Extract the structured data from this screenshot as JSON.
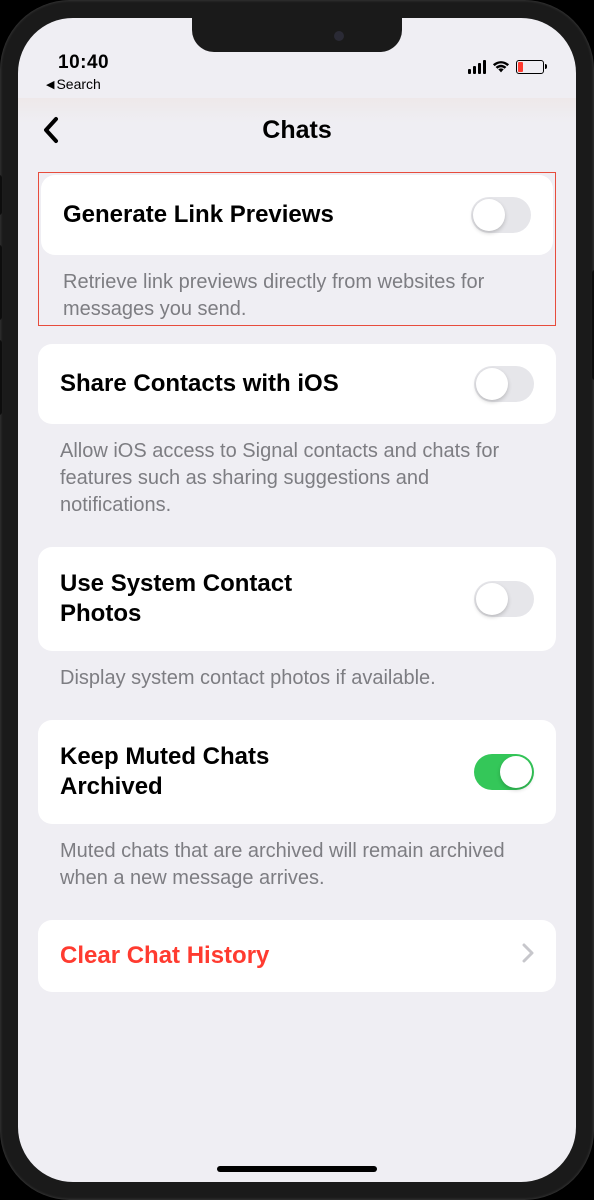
{
  "status": {
    "time": "10:40",
    "breadcrumb": "Search"
  },
  "nav": {
    "title": "Chats"
  },
  "settings": [
    {
      "title": "Generate Link Previews",
      "description": "Retrieve link previews directly from websites for messages you send.",
      "enabled": false,
      "highlighted": true
    },
    {
      "title": "Share Contacts with iOS",
      "description": "Allow iOS access to Signal contacts and chats for features such as sharing suggestions and notifications.",
      "enabled": false,
      "highlighted": false
    },
    {
      "title": "Use System Contact Photos",
      "description": "Display system contact photos if available.",
      "enabled": false,
      "highlighted": false
    },
    {
      "title": "Keep Muted Chats Archived",
      "description": "Muted chats that are archived will remain archived when a new message arrives.",
      "enabled": true,
      "highlighted": false
    }
  ],
  "action": {
    "label": "Clear Chat History"
  }
}
